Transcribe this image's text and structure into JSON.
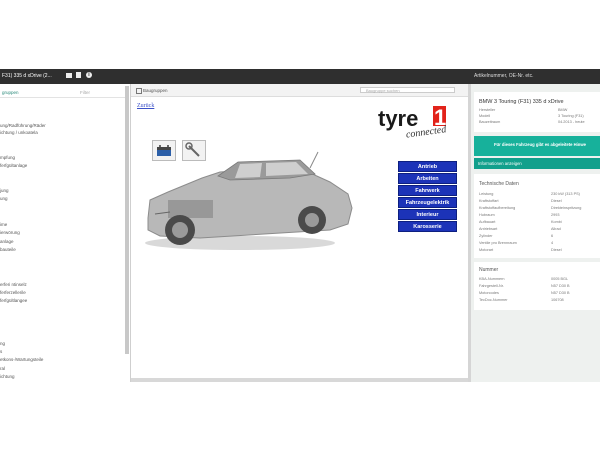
{
  "topbar": {
    "title": "F31) 335 d xDrive (2...",
    "search_placeholder": "Artikelnummer, OE-Nr. etc."
  },
  "left_panel": {
    "tab_active": "gruppen",
    "tab_inactive": "Filter",
    "items": [
      "ung/Radführung/Räder",
      "ichtung / unkoatela",
      "mpfung",
      "ferfgültanlage",
      "jung",
      "ung",
      "ime",
      "ierwörung",
      "anlage",
      "bauteile",
      "erferi ntinselz",
      "ferferzellerile",
      "ferfgültlangee",
      "ng",
      "s",
      "etkons-/Wartungsteile",
      "ral",
      "ichtung"
    ]
  },
  "middle": {
    "header_label": "Baugruppen",
    "search_placeholder": "Baugruppe suchen",
    "back_link": "Zurück",
    "logo_main": "tyre",
    "logo_digit": "1",
    "logo_sub": "connected",
    "categories": [
      "Antrieb",
      "Arbeiten",
      "Fahrwerk",
      "Fahrzeugelektrik",
      "Interieur",
      "Karosserie"
    ]
  },
  "right_panel": {
    "vehicle_title": "BMW 3 Touring (F31) 335 d xDrive",
    "vehicle_info": [
      {
        "label": "Hersteller",
        "value": "BMW"
      },
      {
        "label": "Modell",
        "value": "3 Touring (F31)"
      },
      {
        "label": "Bauzeitraum",
        "value": "04.2013 - heute"
      }
    ],
    "alert_text": "Für dieses Fahrzeug gibt es abgeleitete Hinwe",
    "alert_link": "Informationen anzeigen",
    "tech_title": "Technische Daten",
    "tech_data": [
      {
        "label": "Leistung",
        "value": "230 kW (313 PS)"
      },
      {
        "label": "Kraftstoffart",
        "value": "Diesel"
      },
      {
        "label": "Kraftstoffaufbereitung",
        "value": "Direkteinspritzung"
      },
      {
        "label": "Hubraum",
        "value": "2993"
      },
      {
        "label": "Aufbauart",
        "value": "Kombi"
      },
      {
        "label": "Antriebsart",
        "value": "Allrad"
      },
      {
        "label": "Zylinder",
        "value": "6"
      },
      {
        "label": "Ventile pro Brennraum",
        "value": "4"
      },
      {
        "label": "Motorart",
        "value": "Diesel"
      }
    ],
    "num_title": "Nummer",
    "numbers": [
      {
        "label": "KBA-Nummern",
        "value": "0005 BGL"
      },
      {
        "label": "Fahrgestell-Nr.",
        "value": "N57 D30 B"
      },
      {
        "label": "Motorcodes",
        "value": "N57 D30 B"
      },
      {
        "label": "TecDoc-Nummer",
        "value": "106708"
      }
    ]
  },
  "colors": {
    "accent_teal": "#17b19b",
    "category_blue": "#1c33b8",
    "logo_red": "#e2231a",
    "topbar": "#2f2f2f"
  }
}
